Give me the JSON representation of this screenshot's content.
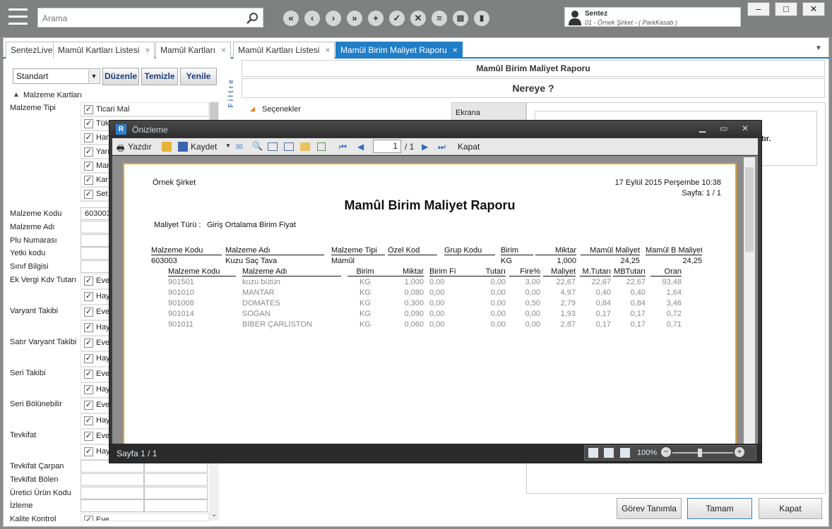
{
  "search": {
    "placeholder": "Arama"
  },
  "user": {
    "name": "Sentez",
    "company": "01 - Örnek Şirket - ( ParkKasab )"
  },
  "tabs": [
    {
      "label": "SentezLive",
      "closable": false
    },
    {
      "label": "Mamûl Kartları Listesi",
      "closable": true
    },
    {
      "label": "Mamûl Kartları",
      "closable": true
    },
    {
      "label": "Mamûl Kartları Listesi",
      "closable": true
    },
    {
      "label": "Mamûl Birim Maliyet Raporu",
      "closable": true,
      "active": true
    }
  ],
  "close_glyph": "×",
  "filter": {
    "preset": "Standart",
    "buttons": {
      "edit": "Düzenle",
      "clear": "Temizle",
      "refresh": "Yenile"
    },
    "section": "Malzeme Kartları",
    "vertical_label": "Filtre",
    "rows": [
      {
        "label": "Malzeme Tipi",
        "checks": [
          "Ticari Mal",
          "Tük",
          "Ham",
          "Yarı",
          "Mar",
          "Kar",
          "Set"
        ]
      },
      {
        "label": "Malzeme Kodu",
        "value": "603003"
      },
      {
        "label": "Malzeme Adı"
      },
      {
        "label": "Plu Numarası"
      },
      {
        "label": "Yetki kodu"
      },
      {
        "label": "Sınıf Bilgisi"
      },
      {
        "label": "Ek Vergi Kdv Tutarı",
        "checks": [
          "Eve",
          "Hay"
        ]
      },
      {
        "label": "Varyant Takibi",
        "checks": [
          "Eve",
          "Hay"
        ]
      },
      {
        "label": "Satır Varyant Takibi",
        "checks": [
          "Eve",
          "Hay"
        ]
      },
      {
        "label": "Seri Takibi",
        "checks": [
          "Eve",
          "Hay"
        ]
      },
      {
        "label": "Seri Bölünebilir",
        "checks": [
          "Eve",
          "Hay"
        ]
      },
      {
        "label": "Tevkifat",
        "checks": [
          "Eve",
          "Hay"
        ]
      },
      {
        "label": "Tevkifat Çarpan"
      },
      {
        "label": "Tevkifat Bölen"
      },
      {
        "label": "Üretici Ürün Kodu"
      },
      {
        "label": "İzleme"
      },
      {
        "label": "Kalite Kontrol",
        "checks": [
          "Evet"
        ]
      }
    ]
  },
  "report_header": {
    "title": "Mamûl Birim Maliyet Raporu",
    "destination": "Nereye ?",
    "options": "Seçenekler",
    "screen": "Ekrana",
    "partial": "tır."
  },
  "bottom_buttons": {
    "task": "Görev Tanımla",
    "ok": "Tamam",
    "close": "Kapat"
  },
  "preview": {
    "title": "Önizleme",
    "toolbar": {
      "print": "Yazdır",
      "save": "Kaydet",
      "page_value": "1",
      "page_total": "/ 1",
      "close": "Kapat"
    },
    "status": "Sayfa 1 / 1",
    "zoom": "100%",
    "report": {
      "company": "Örnek Şirket",
      "date": "17 Eylül 2015 Perşembe 10:38",
      "page": "Sayfa: 1 / 1",
      "title": "Mamûl Birim Maliyet Raporu",
      "cost_type_label": "Maliyet Türü :",
      "cost_type": "Giriş Ortalama Birim Fiyat",
      "main_headers": [
        "Malzeme Kodu",
        "Malzeme Adı",
        "Malzeme Tipi",
        "Özel Kod",
        "Grup Kodu",
        "Birim",
        "Miktar",
        "Mamûl Maliyet",
        "Mamûl B Maliyet"
      ],
      "main_row": {
        "code": "603003",
        "name": "Kuzu Saç Tava",
        "type": "Mamûl",
        "unit": "KG",
        "qty": "1,000",
        "cost": "24,25",
        "unit_cost": "24,25"
      },
      "sub_headers": [
        "Malzeme Kodu",
        "Malzeme Adı",
        "Birim",
        "Miktar",
        "Birim Fi",
        "Tutarı",
        "Fire%",
        "Maliyet",
        "M.Tutarı",
        "MBTutarı",
        "Oran"
      ],
      "sub_rows": [
        [
          "901501",
          "kuzu bütün",
          "KG",
          "1,000",
          "0,00",
          "0,00",
          "3,00",
          "22,67",
          "22,67",
          "22,67",
          "93,48"
        ],
        [
          "901010",
          "MANTAR",
          "KG",
          "0,080",
          "0,00",
          "0,00",
          "0,00",
          "4,97",
          "0,40",
          "0,40",
          "1,64"
        ],
        [
          "901008",
          "DOMATES",
          "KG",
          "0,300",
          "0,00",
          "0,00",
          "0,50",
          "2,79",
          "0,84",
          "0,84",
          "3,46"
        ],
        [
          "901014",
          "SOĞAN",
          "KG",
          "0,090",
          "0,00",
          "0,00",
          "0,00",
          "1,93",
          "0,17",
          "0,17",
          "0,72"
        ],
        [
          "901011",
          "BİBER ÇARLİSTON",
          "KG",
          "0,060",
          "0,00",
          "0,00",
          "0,00",
          "2,87",
          "0,17",
          "0,17",
          "0,71"
        ]
      ]
    }
  },
  "colors": {
    "accent": "#1f7ec7",
    "report_border": "#e6a530"
  }
}
